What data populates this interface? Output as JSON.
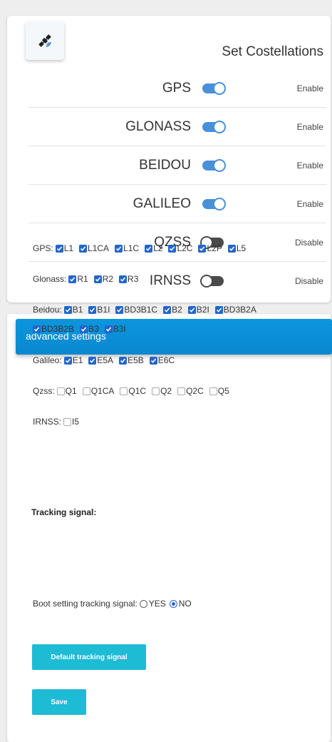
{
  "constellations": {
    "title": "Set Costellations",
    "icon": "satellite-icon",
    "rows": [
      {
        "name": "GPS",
        "on": true,
        "status": "Enable"
      },
      {
        "name": "GLONASS",
        "on": true,
        "status": "Enable"
      },
      {
        "name": "BEIDOU",
        "on": true,
        "status": "Enable"
      },
      {
        "name": "GALILEO",
        "on": true,
        "status": "Enable"
      },
      {
        "name": "QZSS",
        "on": false,
        "status": "Disable"
      },
      {
        "name": "IRNSS",
        "on": false,
        "status": "Disable"
      }
    ]
  },
  "advanced": {
    "header": "advanced settings",
    "tracking_title": "Tracking signal:",
    "groups": [
      {
        "label": "GPS:",
        "lines": [
          [
            {
              "name": "L1",
              "checked": true
            },
            {
              "name": "L1CA",
              "checked": true
            },
            {
              "name": "L1C",
              "checked": true
            },
            {
              "name": "L2",
              "checked": true
            },
            {
              "name": "L2C",
              "checked": true
            },
            {
              "name": "L2P",
              "checked": true
            },
            {
              "name": "L5",
              "checked": true
            }
          ]
        ]
      },
      {
        "label": "Glonass:",
        "lines": [
          [
            {
              "name": "R1",
              "checked": true
            },
            {
              "name": "R2",
              "checked": true
            },
            {
              "name": "R3",
              "checked": true
            }
          ]
        ]
      },
      {
        "label": "Beidou:",
        "lines": [
          [
            {
              "name": "B1",
              "checked": true
            },
            {
              "name": "B1I",
              "checked": true
            },
            {
              "name": "BD3B1C",
              "checked": true
            },
            {
              "name": "B2",
              "checked": true
            },
            {
              "name": "B2I",
              "checked": true
            },
            {
              "name": "BD3B2A",
              "checked": true
            }
          ],
          [
            {
              "name": "BD3B2B",
              "checked": true
            },
            {
              "name": "B3",
              "checked": true
            },
            {
              "name": "B3I",
              "checked": true
            }
          ]
        ]
      },
      {
        "label": "Galileo:",
        "lines": [
          [
            {
              "name": "E1",
              "checked": true
            },
            {
              "name": "E5A",
              "checked": true
            },
            {
              "name": "E5B",
              "checked": true
            },
            {
              "name": "E6C",
              "checked": true
            }
          ]
        ]
      },
      {
        "label": "Qzss:",
        "lines": [
          [
            {
              "name": "Q1",
              "checked": false
            },
            {
              "name": "Q1CA",
              "checked": false
            },
            {
              "name": "Q1C",
              "checked": false
            },
            {
              "name": "Q2",
              "checked": false
            },
            {
              "name": "Q2C",
              "checked": false
            },
            {
              "name": "Q5",
              "checked": false
            }
          ]
        ]
      },
      {
        "label": "IRNSS:",
        "lines": [
          [
            {
              "name": "I5",
              "checked": false
            }
          ]
        ]
      }
    ],
    "boot": {
      "label": "Boot setting tracking signal:",
      "options": [
        {
          "name": "YES",
          "selected": false
        },
        {
          "name": "NO",
          "selected": true
        }
      ]
    },
    "default_button": "Default tracking signal",
    "save_button": "Save"
  }
}
